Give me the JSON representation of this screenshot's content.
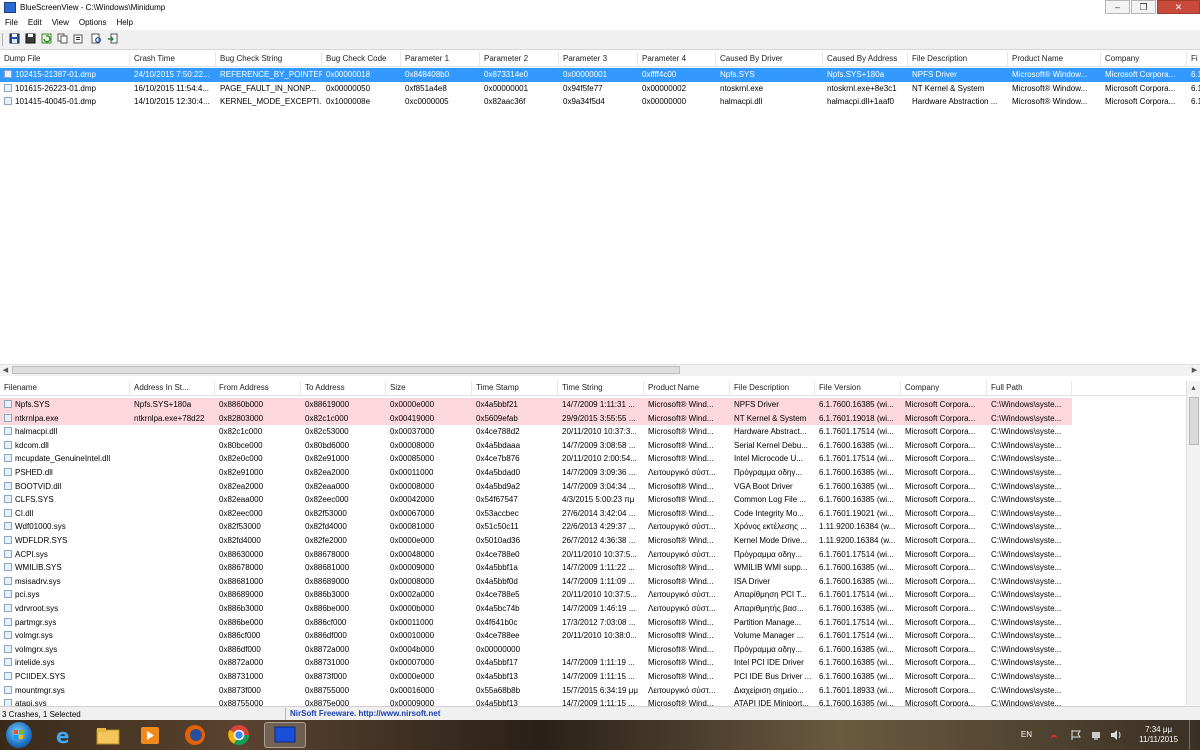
{
  "window": {
    "title": "BlueScreenView  -  C:\\Windows\\Minidump",
    "minimize_glyph": "–",
    "maximize_glyph": "❐",
    "close_glyph": "✕"
  },
  "menu": [
    "File",
    "Edit",
    "View",
    "Options",
    "Help"
  ],
  "toolbar_icons": [
    "save-icon",
    "save-selected-icon",
    "refresh-icon",
    "copy-icon",
    "properties-icon",
    "find-icon",
    "exit-icon"
  ],
  "crash_table": {
    "columns": [
      "Dump File",
      "Crash Time",
      "Bug Check String",
      "Bug Check Code",
      "Parameter 1",
      "Parameter 2",
      "Parameter 3",
      "Parameter 4",
      "Caused By Driver",
      "Caused By Address",
      "File Description",
      "Product Name",
      "Company",
      "Fi"
    ],
    "sort_indicator": "▿",
    "rows": [
      [
        "102415-21387-01.dmp",
        "24/10/2015 7:50:22...",
        "REFERENCE_BY_POINTER",
        "0x00000018",
        "0x848408b0",
        "0x873314e0",
        "0x00000001",
        "0xffff4c00",
        "Npfs.SYS",
        "Npfs.SYS+180a",
        "NPFS Driver",
        "Microsoft® Window...",
        "Microsoft Corpora...",
        "6.1"
      ],
      [
        "101615-26223-01.dmp",
        "16/10/2015 11:54:4...",
        "PAGE_FAULT_IN_NONP...",
        "0x00000050",
        "0xf851a4e8",
        "0x00000001",
        "0x94f5fe77",
        "0x00000002",
        "ntoskrnl.exe",
        "ntoskrnl.exe+8e3c1",
        "NT Kernel & System",
        "Microsoft® Window...",
        "Microsoft Corpora...",
        "6.1"
      ],
      [
        "101415-40045-01.dmp",
        "14/10/2015 12:30:4...",
        "KERNEL_MODE_EXCEPTI...",
        "0x1000008e",
        "0xc0000005",
        "0x82aac36f",
        "0x9a34f5d4",
        "0x00000000",
        "halmacpi.dll",
        "halmacpi.dll+1aaf0",
        "Hardware Abstraction ...",
        "Microsoft® Window...",
        "Microsoft Corpora...",
        "6.1"
      ]
    ]
  },
  "driver_table": {
    "columns": [
      "Filename",
      "Address In St...",
      "From Address",
      "To Address",
      "Size",
      "Time Stamp",
      "Time String",
      "Product Name",
      "File Description",
      "File Version",
      "Company",
      "Full Path"
    ],
    "sort_indicator": "/",
    "rows": [
      [
        "Npfs.SYS",
        "Npfs.SYS+180a",
        "0x8860b000",
        "0x88619000",
        "0x0000e000",
        "0x4a5bbf21",
        "14/7/2009 1:11:31 ...",
        "Microsoft® Wind...",
        "NPFS Driver",
        "6.1.7600.16385 (wi...",
        "Microsoft Corpora...",
        "C:\\Windows\\syste..."
      ],
      [
        "ntkrnlpa.exe",
        "ntkrnlpa.exe+78d22",
        "0x82803000",
        "0x82c1c000",
        "0x00419000",
        "0x5609efab",
        "29/9/2015 3:55:55 ...",
        "Microsoft® Wind...",
        "NT Kernel & System",
        "6.1.7601.19018 (wi...",
        "Microsoft Corpora...",
        "C:\\Windows\\syste..."
      ],
      [
        "halmacpi.dll",
        "",
        "0x82c1c000",
        "0x82c53000",
        "0x00037000",
        "0x4ce788d2",
        "20/11/2010 10:37:3...",
        "Microsoft® Wind...",
        "Hardware Abstract...",
        "6.1.7601.17514 (wi...",
        "Microsoft Corpora...",
        "C:\\Windows\\syste..."
      ],
      [
        "kdcom.dll",
        "",
        "0x80bce000",
        "0x80bd6000",
        "0x00008000",
        "0x4a5bdaaa",
        "14/7/2009 3:08:58 ...",
        "Microsoft® Wind...",
        "Serial Kernel Debu...",
        "6.1.7600.16385 (wi...",
        "Microsoft Corpora...",
        "C:\\Windows\\syste..."
      ],
      [
        "mcupdate_GenuineIntel.dll",
        "",
        "0x82e0c000",
        "0x82e91000",
        "0x00085000",
        "0x4ce7b876",
        "20/11/2010 2:00:54...",
        "Microsoft® Wind...",
        "Intel Microcode U...",
        "6.1.7601.17514 (wi...",
        "Microsoft Corpora...",
        "C:\\Windows\\syste..."
      ],
      [
        "PSHED.dll",
        "",
        "0x82e91000",
        "0x82ea2000",
        "0x00011000",
        "0x4a5bdad0",
        "14/7/2009 3:09:36 ...",
        "Λειτουργικό σύστ...",
        "Πρόγραμμα οδηγ...",
        "6.1.7600.16385 (wi...",
        "Microsoft Corpora...",
        "C:\\Windows\\syste..."
      ],
      [
        "BOOTVID.dll",
        "",
        "0x82ea2000",
        "0x82eaa000",
        "0x00008000",
        "0x4a5bd9a2",
        "14/7/2009 3:04:34 ...",
        "Microsoft® Wind...",
        "VGA Boot Driver",
        "6.1.7600.16385 (wi...",
        "Microsoft Corpora...",
        "C:\\Windows\\syste..."
      ],
      [
        "CLFS.SYS",
        "",
        "0x82eaa000",
        "0x82eec000",
        "0x00042000",
        "0x54f67547",
        "4/3/2015 5:00:23 πμ",
        "Microsoft® Wind...",
        "Common Log File ...",
        "6.1.7600.16385 (wi...",
        "Microsoft Corpora...",
        "C:\\Windows\\syste..."
      ],
      [
        "CI.dll",
        "",
        "0x82eec000",
        "0x82f53000",
        "0x00067000",
        "0x53accbec",
        "27/6/2014 3:42:04 ...",
        "Microsoft® Wind...",
        "Code Integrity Mo...",
        "6.1.7601.19021 (wi...",
        "Microsoft Corpora...",
        "C:\\Windows\\syste..."
      ],
      [
        "Wdf01000.sys",
        "",
        "0x82f53000",
        "0x82fd4000",
        "0x00081000",
        "0x51c50c11",
        "22/6/2013 4:29:37 ...",
        "Λειτουργικό σύστ...",
        "Χρόνος εκτέλεσης ...",
        "1.11.9200.16384 (w...",
        "Microsoft Corpora...",
        "C:\\Windows\\syste..."
      ],
      [
        "WDFLDR.SYS",
        "",
        "0x82fd4000",
        "0x82fe2000",
        "0x0000e000",
        "0x5010ad36",
        "26/7/2012 4:36:38 ...",
        "Microsoft® Wind...",
        "Kernel Mode Drive...",
        "1.11.9200.16384 (w...",
        "Microsoft Corpora...",
        "C:\\Windows\\syste..."
      ],
      [
        "ACPI.sys",
        "",
        "0x88630000",
        "0x88678000",
        "0x00048000",
        "0x4ce788e0",
        "20/11/2010 10:37:5...",
        "Λειτουργικό σύστ...",
        "Πρόγραμμα οδηγ...",
        "6.1.7601.17514 (wi...",
        "Microsoft Corpora...",
        "C:\\Windows\\syste..."
      ],
      [
        "WMILIB.SYS",
        "",
        "0x88678000",
        "0x88681000",
        "0x00009000",
        "0x4a5bbf1a",
        "14/7/2009 1:11:22 ...",
        "Microsoft® Wind...",
        "WMILIB WMI supp...",
        "6.1.7600.16385 (wi...",
        "Microsoft Corpora...",
        "C:\\Windows\\syste..."
      ],
      [
        "msisadrv.sys",
        "",
        "0x88681000",
        "0x88689000",
        "0x00008000",
        "0x4a5bbf0d",
        "14/7/2009 1:11:09 ...",
        "Microsoft® Wind...",
        "ISA Driver",
        "6.1.7600.16385 (wi...",
        "Microsoft Corpora...",
        "C:\\Windows\\syste..."
      ],
      [
        "pci.sys",
        "",
        "0x88689000",
        "0x886b3000",
        "0x0002a000",
        "0x4ce788e5",
        "20/11/2010 10:37:5...",
        "Λειτουργικό σύστ...",
        "Απαρίθμηση PCI T...",
        "6.1.7601.17514 (wi...",
        "Microsoft Corpora...",
        "C:\\Windows\\syste..."
      ],
      [
        "vdrvroot.sys",
        "",
        "0x886b3000",
        "0x886be000",
        "0x0000b000",
        "0x4a5bc74b",
        "14/7/2009 1:46:19 ...",
        "Λειτουργικό σύστ...",
        "Απαριθμητής βασ...",
        "6.1.7600.16385 (wi...",
        "Microsoft Corpora...",
        "C:\\Windows\\syste..."
      ],
      [
        "partmgr.sys",
        "",
        "0x886be000",
        "0x886cf000",
        "0x00011000",
        "0x4f641b0c",
        "17/3/2012 7:03:08 ...",
        "Microsoft® Wind...",
        "Partition Manage...",
        "6.1.7601.17514 (wi...",
        "Microsoft Corpora...",
        "C:\\Windows\\syste..."
      ],
      [
        "volmgr.sys",
        "",
        "0x886cf000",
        "0x886df000",
        "0x00010000",
        "0x4ce788ee",
        "20/11/2010 10:38:0...",
        "Microsoft® Wind...",
        "Volume Manager ...",
        "6.1.7601.17514 (wi...",
        "Microsoft Corpora...",
        "C:\\Windows\\syste..."
      ],
      [
        "volmgrx.sys",
        "",
        "0x886df000",
        "0x8872a000",
        "0x0004b000",
        "0x00000000",
        "",
        "Microsoft® Wind...",
        "Πρόγραμμα οδηγ...",
        "6.1.7600.16385 (wi...",
        "Microsoft Corpora...",
        "C:\\Windows\\syste..."
      ],
      [
        "intelide.sys",
        "",
        "0x8872a000",
        "0x88731000",
        "0x00007000",
        "0x4a5bbf17",
        "14/7/2009 1:11:19 ...",
        "Microsoft® Wind...",
        "Intel PCI IDE Driver",
        "6.1.7600.16385 (wi...",
        "Microsoft Corpora...",
        "C:\\Windows\\syste..."
      ],
      [
        "PCIIDEX.SYS",
        "",
        "0x88731000",
        "0x8873f000",
        "0x0000e000",
        "0x4a5bbf13",
        "14/7/2009 1:11:15 ...",
        "Microsoft® Wind...",
        "PCI IDE Bus Driver ...",
        "6.1.7600.16385 (wi...",
        "Microsoft Corpora...",
        "C:\\Windows\\syste..."
      ],
      [
        "mountmgr.sys",
        "",
        "0x8873f000",
        "0x88755000",
        "0x00016000",
        "0x55a68b8b",
        "15/7/2015 6:34:19 μμ",
        "Λειτουργικό σύστ...",
        "Διαχείριση σημείο...",
        "6.1.7601.18933 (wi...",
        "Microsoft Corpora...",
        "C:\\Windows\\syste..."
      ],
      [
        "atapi.sys",
        "",
        "0x88755000",
        "0x8875e000",
        "0x00009000",
        "0x4a5bbf13",
        "14/7/2009 1:11:15 ...",
        "Microsoft® Wind...",
        "ATAPI IDE Miniport...",
        "6.1.7600.16385 (wi...",
        "Microsoft Corpora...",
        "C:\\Windows\\syste..."
      ]
    ]
  },
  "status": {
    "left": "3 Crashes, 1 Selected",
    "right": "NirSoft Freeware.  http://www.nirsoft.net"
  },
  "taskbar": {
    "apps": [
      "internet-explorer-icon",
      "file-explorer-icon",
      "media-player-icon",
      "firefox-icon",
      "chrome-icon",
      "bluescreenview-icon"
    ],
    "language": "EN",
    "time": "7:34 μμ",
    "date": "11/11/2015"
  },
  "colors": {
    "selection": "#3399ff",
    "highlight_row": "#fcd8de",
    "status_link": "#1a3fb0",
    "close_button": "#c74a3c"
  }
}
